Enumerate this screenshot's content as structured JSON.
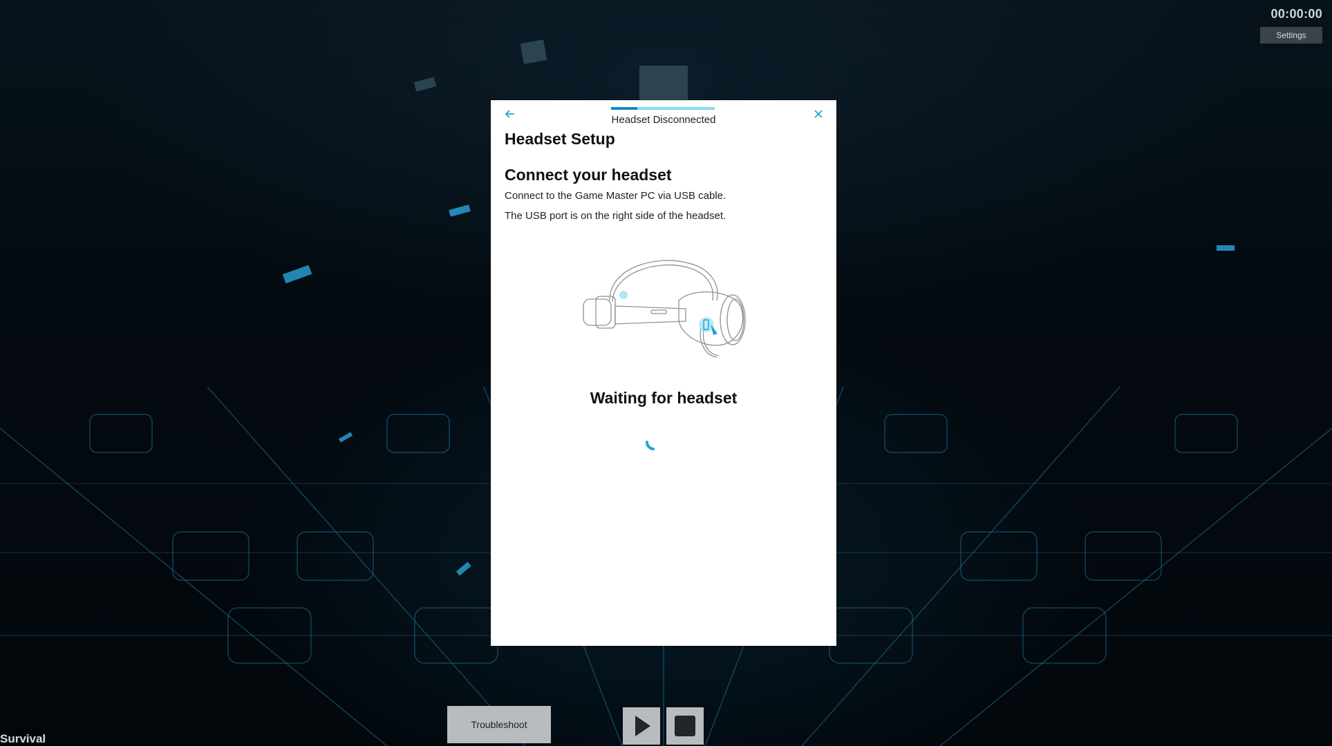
{
  "hud": {
    "timer": "00:00:00",
    "settings_label": "Settings",
    "mode_label": "Survival"
  },
  "controls": {
    "troubleshoot_label": "Troubleshoot",
    "play_icon": "play-icon",
    "stop_icon": "stop-icon"
  },
  "dialog": {
    "status": "Headset Disconnected",
    "progress": 0.25,
    "title": "Headset Setup",
    "step_heading": "Connect your headset",
    "instruction_1": "Connect to the Game Master PC via USB cable.",
    "instruction_2": "The USB port is on the right side of the headset.",
    "waiting": "Waiting for headset",
    "back_icon": "arrow-left-icon",
    "close_icon": "close-icon",
    "accent_color": "#19a9d4"
  }
}
